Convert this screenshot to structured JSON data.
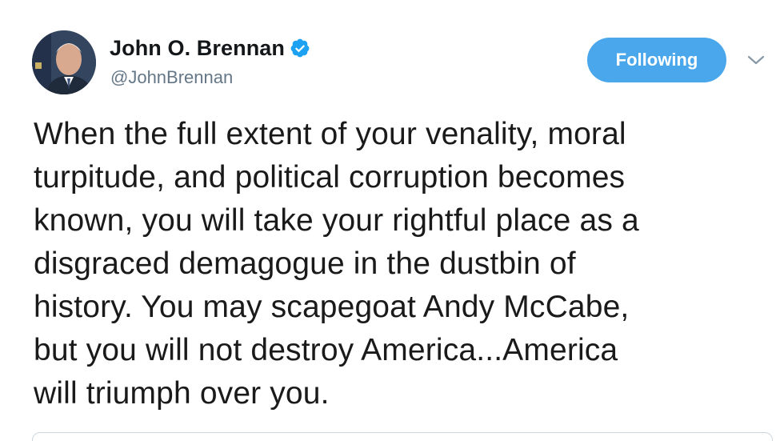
{
  "author": {
    "display_name": "John O. Brennan",
    "handle": "@JohnBrennan",
    "verified": true
  },
  "follow_button": {
    "label": "Following"
  },
  "tweet": {
    "text": "When the full extent of your venality, moral\nturpitude, and political corruption becomes\nknown, you will take your rightful place as a\ndisgraced demagogue in the dustbin of\nhistory. You may scapegoat Andy McCabe,\nbut you will  not destroy America...America\nwill triumph over you."
  },
  "icons": {
    "verified": "verified-badge-icon",
    "caret": "chevron-down-icon"
  },
  "colors": {
    "accent": "#4aa7ec",
    "verified": "#1da1f2",
    "secondary_text": "#657786"
  }
}
